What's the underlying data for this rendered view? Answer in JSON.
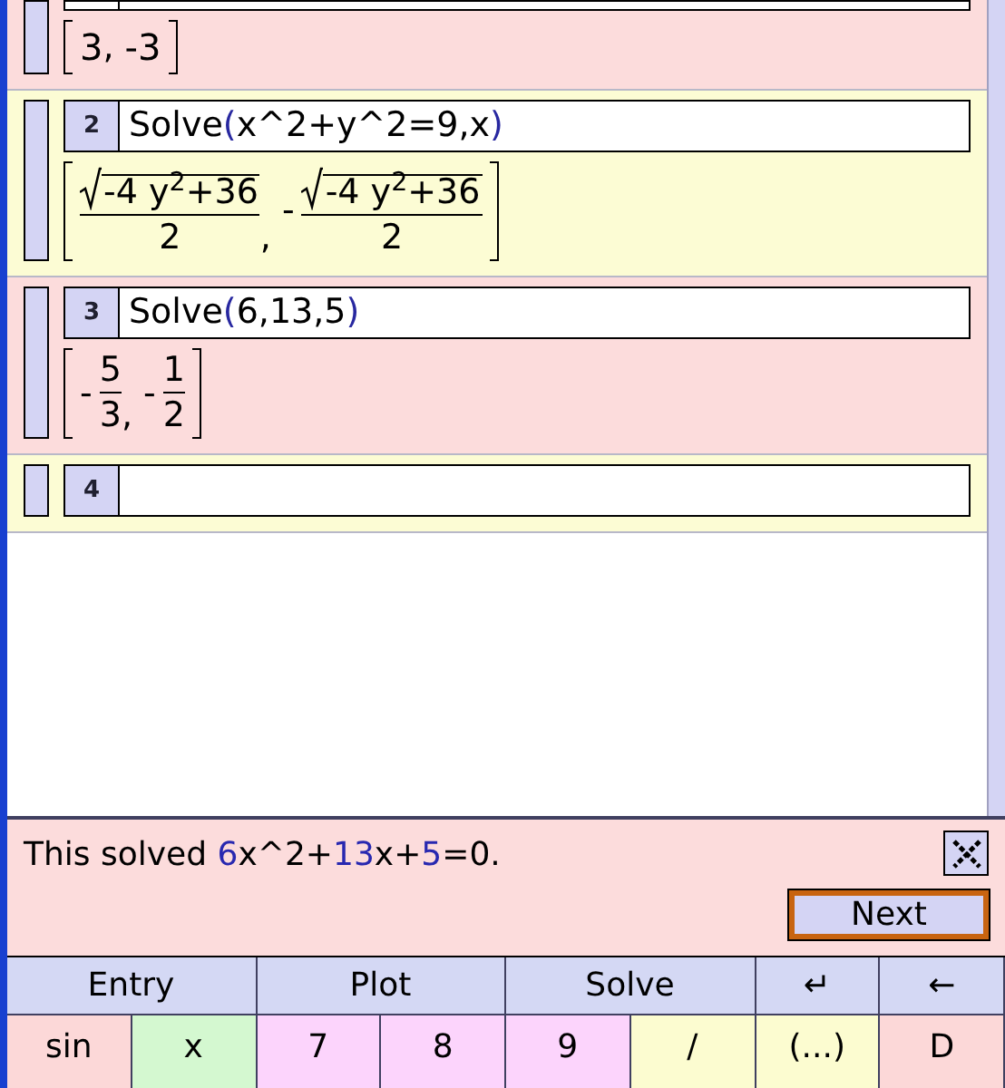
{
  "cells": [
    {
      "result": [
        {
          "kind": "plain",
          "text": "3",
          "comma": ","
        },
        {
          "kind": "plain",
          "text": "-3"
        }
      ]
    },
    {
      "number": "2",
      "input": [
        {
          "kind": "plain",
          "text": "Solve"
        },
        {
          "kind": "paren",
          "text": "("
        },
        {
          "kind": "plain",
          "text": "x^2+y^2=9,x"
        },
        {
          "kind": "paren",
          "text": ")"
        }
      ],
      "result": [
        {
          "kind": "root-fraction",
          "numerator": "-4 y$^{2}$+36",
          "denominator": "2",
          "comma": ","
        },
        {
          "kind": "root-fraction",
          "sign": "-",
          "numerator": "-4 y$^{2}$+36",
          "denominator": "2"
        }
      ]
    },
    {
      "number": "3",
      "input": [
        {
          "kind": "plain",
          "text": "Solve"
        },
        {
          "kind": "paren",
          "text": "("
        },
        {
          "kind": "plain",
          "text": "6,13,5"
        },
        {
          "kind": "paren",
          "text": ")"
        }
      ],
      "result": [
        {
          "kind": "fraction",
          "sign": "-",
          "numerator": "5",
          "denominator": "3",
          "comma": ","
        },
        {
          "kind": "fraction",
          "sign": "-",
          "numerator": "1",
          "denominator": "2"
        }
      ]
    },
    {
      "number": "4"
    }
  ],
  "hint": {
    "text": [
      {
        "kind": "plain",
        "text": "This solved "
      },
      {
        "kind": "number",
        "text": "6"
      },
      {
        "kind": "plain",
        "text": "x^2+"
      },
      {
        "kind": "number",
        "text": "13"
      },
      {
        "kind": "plain",
        "text": "x+"
      },
      {
        "kind": "number",
        "text": "5"
      },
      {
        "kind": "plain",
        "text": "=0."
      }
    ],
    "next_button": "Next"
  },
  "mode_keys": [
    "Entry",
    "Plot",
    "Solve",
    "↵",
    "←"
  ],
  "keys": [
    {
      "label": "sin",
      "color": "#fcd8d8"
    },
    {
      "label": "x",
      "color": "#d4f8d0"
    },
    {
      "label": "7",
      "color": "#fcd4fc"
    },
    {
      "label": "8",
      "color": "#fcd4fc"
    },
    {
      "label": "9",
      "color": "#fcd4fc"
    },
    {
      "label": "/",
      "color": "#fcfcd0"
    },
    {
      "label": "(...)",
      "color": "#fcfcd0"
    },
    {
      "label": "D",
      "color": "#fcd8d8"
    }
  ]
}
